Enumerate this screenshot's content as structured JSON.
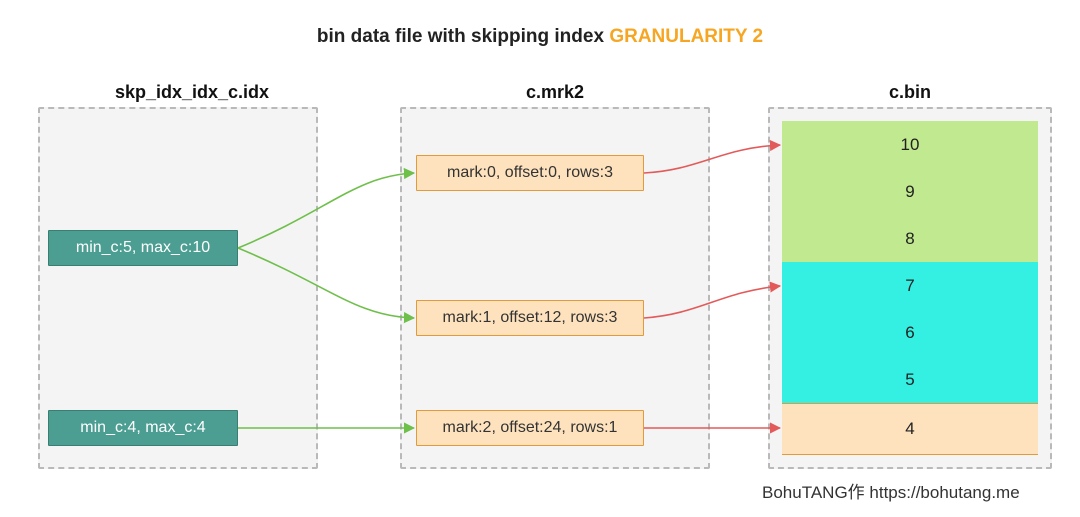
{
  "title_prefix": "bin data file with skipping index ",
  "title_highlight": "GRANULARITY 2",
  "columns": {
    "idx": {
      "label": "skp_idx_idx_c.idx"
    },
    "mrk": {
      "label": "c.mrk2"
    },
    "bin": {
      "label": "c.bin"
    }
  },
  "idx_rows": [
    {
      "text": "min_c:5, max_c:10"
    },
    {
      "text": "min_c:4, max_c:4"
    }
  ],
  "mark_rows": [
    {
      "text": "mark:0, offset:0,  rows:3"
    },
    {
      "text": "mark:1, offset:12,  rows:3"
    },
    {
      "text": "mark:2, offset:24,  rows:1"
    }
  ],
  "bin_cells": [
    {
      "value": "10",
      "group": 1
    },
    {
      "value": "9",
      "group": 1
    },
    {
      "value": "8",
      "group": 1
    },
    {
      "value": "7",
      "group": 2
    },
    {
      "value": "6",
      "group": 2
    },
    {
      "value": "5",
      "group": 2
    },
    {
      "value": "4",
      "group": 3
    }
  ],
  "credit_author": "BohuTANG作 ",
  "credit_url": "https://bohutang.me",
  "chart_data": {
    "type": "table",
    "title": "bin data file with skipping index GRANULARITY 2",
    "description": "Diagram showing how a ClickHouse skip index file (skp_idx_idx_c.idx), mark file (c.mrk2), and bin data file (c.bin) relate, with GRANULARITY 2.",
    "skip_index": [
      {
        "min_c": 5,
        "max_c": 10,
        "marks": [
          0,
          1
        ]
      },
      {
        "min_c": 4,
        "max_c": 4,
        "marks": [
          2
        ]
      }
    ],
    "marks": [
      {
        "mark": 0,
        "offset": 0,
        "rows": 3,
        "values": [
          10,
          9,
          8
        ]
      },
      {
        "mark": 1,
        "offset": 12,
        "rows": 3,
        "values": [
          7,
          6,
          5
        ]
      },
      {
        "mark": 2,
        "offset": 24,
        "rows": 1,
        "values": [
          4
        ]
      }
    ],
    "bin_values": [
      10,
      9,
      8,
      7,
      6,
      5,
      4
    ]
  }
}
